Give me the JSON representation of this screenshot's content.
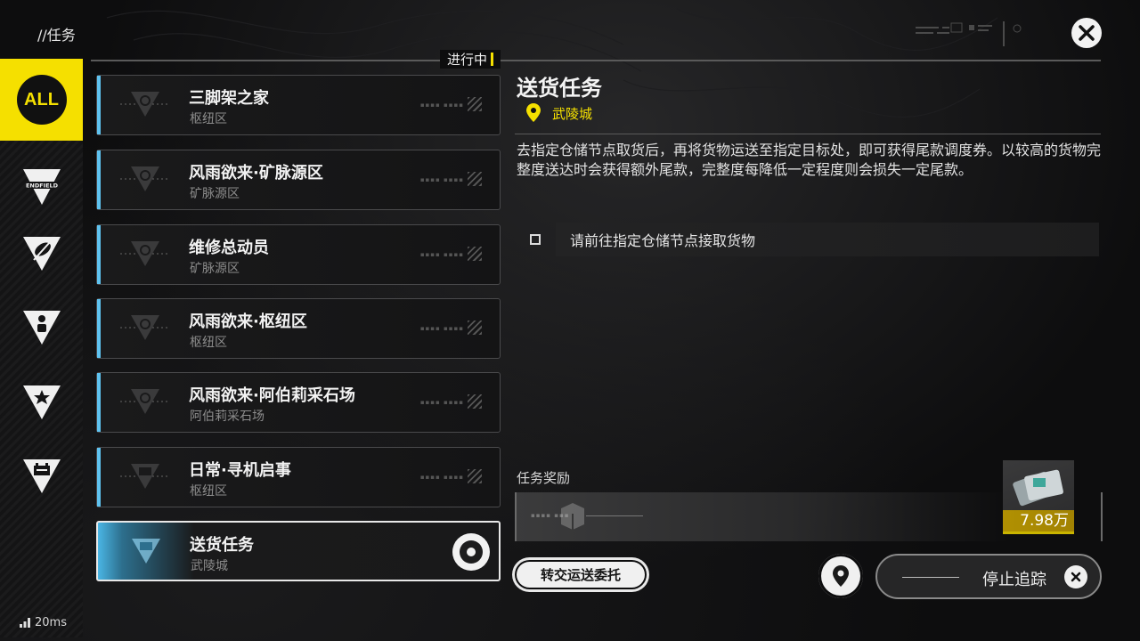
{
  "breadcrumb": "//任务",
  "status_label": "进行中",
  "sidebar": {
    "items": [
      {
        "label": "ALL",
        "icon": "all-badge"
      },
      {
        "label": "ENDFIELD",
        "icon": "endfield-icon"
      },
      {
        "icon": "feather-icon"
      },
      {
        "icon": "person-icon"
      },
      {
        "icon": "star-icon"
      },
      {
        "icon": "battery-icon"
      }
    ]
  },
  "network": {
    "ping": "20ms"
  },
  "missions": [
    {
      "title": "三脚架之家",
      "region": "枢纽区"
    },
    {
      "title": "风雨欲来·矿脉源区",
      "region": "矿脉源区"
    },
    {
      "title": "维修总动员",
      "region": "矿脉源区"
    },
    {
      "title": "风雨欲来·枢纽区",
      "region": "枢纽区"
    },
    {
      "title": "风雨欲来·阿伯莉采石场",
      "region": "阿伯莉采石场"
    },
    {
      "title": "日常·寻机启事",
      "region": "枢纽区"
    },
    {
      "title": "送货任务",
      "region": "武陵城"
    }
  ],
  "detail": {
    "title": "送货任务",
    "location": "武陵城",
    "description": "去指定仓储节点取货后，再将货物运送至指定目标处，即可获得尾款调度券。以较高的货物完整度送达时会获得额外尾款，完整度每降低一定程度则会损失一定尾款。",
    "objective": "请前往指定仓储节点接取货物",
    "reward_label": "任务奖励",
    "reward_qty": "7.98万"
  },
  "actions": {
    "transfer_label": "转交运送委托",
    "stop_label": "停止追踪"
  },
  "colors": {
    "accent": "#f5e000",
    "card_stripe": "#5fc3f0"
  }
}
